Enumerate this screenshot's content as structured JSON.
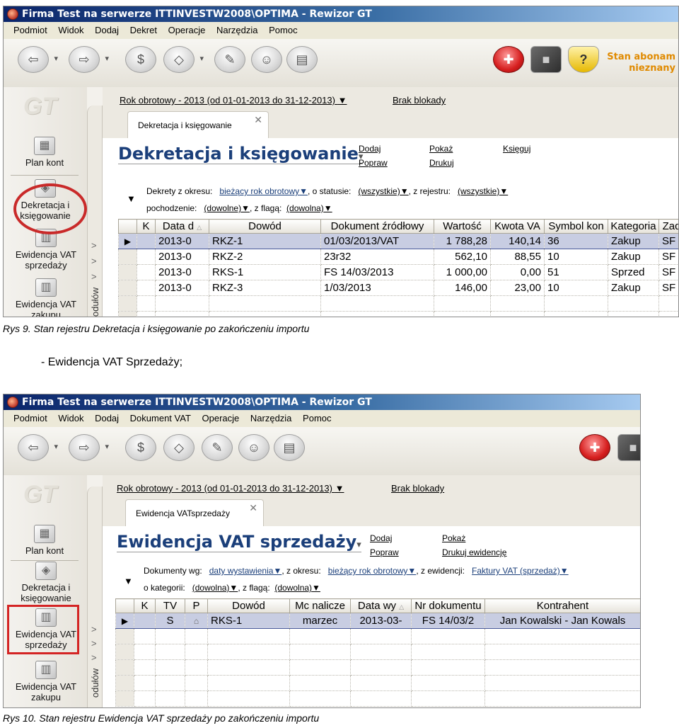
{
  "shot1": {
    "window_title": "Firma Test na serwerze ITTINVESTW2008\\OPTIMA - Rewizor GT",
    "menu": [
      "Podmiot",
      "Widok",
      "Dodaj",
      "Dekret",
      "Operacje",
      "Narzędzia",
      "Pomoc"
    ],
    "stan_line1": "Stan abonam",
    "stan_line2": "nieznany",
    "logo": "GT",
    "nav": [
      "Plan kont",
      "Dekretacja i księgowanie",
      "Ewidencja VAT sprzedaży",
      "Ewidencja VAT zakupu"
    ],
    "vstrip_text": "odułów",
    "year_link": "Rok obrotowy - 2013  (od 01-01-2013 do 31-12-2013)",
    "block_link": "Brak blokady",
    "tab_label": "Dekretacja i księgowanie",
    "page_title": "Dekretacja i księgowanie",
    "actions": {
      "dodaj": "Dodaj",
      "popraw": "Popraw",
      "pokaz": "Pokaż",
      "drukuj": "Drukuj",
      "ksieguj": "Księguj"
    },
    "filters": {
      "l1a": "Dekrety z okresu:",
      "v1a": "bieżący rok obrotowy",
      "l1b": ", o statusie:",
      "v1b": "(wszystkie)",
      "l1c": ", z rejestru:",
      "v1c": "(wszystkie)",
      "l2a": "pochodzenie:",
      "v2a": "(dowolne)",
      "l2b": ", z flagą:",
      "v2b": "(dowolna)"
    },
    "columns": [
      "",
      "K",
      "Data d",
      "Dowód",
      "Dokument źródłowy",
      "Wartość",
      "Kwota VA",
      "Symbol kon",
      "Kategoria",
      "Zad"
    ],
    "rows": [
      [
        "2013-0",
        "RKZ-1",
        "01/03/2013/VAT",
        "1 788,28",
        "140,14",
        "36",
        "Zakup",
        "SF"
      ],
      [
        "2013-0",
        "RKZ-2",
        "23r32",
        "562,10",
        "88,55",
        "10",
        "Zakup",
        "SF"
      ],
      [
        "2013-0",
        "RKS-1",
        "FS 14/03/2013",
        "1 000,00",
        "0,00",
        "51",
        "Sprzed",
        "SF"
      ],
      [
        "2013-0",
        "RKZ-3",
        "1/03/2013",
        "146,00",
        "23,00",
        "10",
        "Zakup",
        "SF"
      ]
    ]
  },
  "caption1": "Rys 9. Stan rejestru Dekretacja i księgowanie po zakończeniu importu",
  "middle_text": "- Ewidencja VAT Sprzedaży;",
  "shot2": {
    "window_title": "Firma Test na serwerze ITTINVESTW2008\\OPTIMA - Rewizor GT",
    "menu": [
      "Podmiot",
      "Widok",
      "Dodaj",
      "Dokument VAT",
      "Operacje",
      "Narzędzia",
      "Pomoc"
    ],
    "logo": "GT",
    "nav": [
      "Plan kont",
      "Dekretacja i księgowanie",
      "Ewidencja VAT sprzedaży",
      "Ewidencja VAT zakupu"
    ],
    "vstrip_text": "odułów",
    "year_link": "Rok obrotowy - 2013  (od 01-01-2013 do 31-12-2013)",
    "block_link": "Brak blokady",
    "tab_label": "Ewidencja VATsprzedaży",
    "page_title": "Ewidencja VAT sprzedaży",
    "actions": {
      "dodaj": "Dodaj",
      "popraw": "Popraw",
      "pokaz": "Pokaż",
      "drukuj": "Drukuj ewidencję"
    },
    "filters": {
      "l1a": "Dokumenty wg:",
      "v1a": "daty wystawienia",
      "l1b": ", z okresu:",
      "v1b": "bieżący rok obrotowy",
      "l1c": ", z ewidencji:",
      "v1c": "Faktury VAT (sprzedaż)",
      "l2a": "o kategorii:",
      "v2a": "(dowolna)",
      "l2b": ", z flagą:",
      "v2b": "(dowolna)"
    },
    "columns": [
      "",
      "K",
      "TV",
      "P",
      "Dowód",
      "Mc nalicze",
      "Data wy",
      "Nr dokumentu",
      "Kontrahent"
    ],
    "rows": [
      [
        "",
        "S",
        "⌂",
        "RKS-1",
        "marzec",
        "2013-03-",
        "FS 14/03/2",
        "Jan Kowalski - Jan Kowals"
      ]
    ]
  },
  "caption2": "Rys 10. Stan rejestru Ewidencja VAT sprzedaży po zakończeniu importu"
}
